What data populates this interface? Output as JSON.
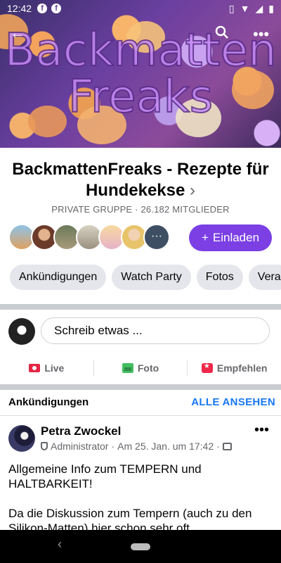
{
  "status": {
    "time": "12:42"
  },
  "cover": {
    "line1": "Backmatten",
    "line2": "Freaks"
  },
  "group": {
    "title": "BackmattenFreaks - Rezepte für Hundekekse",
    "chevron": "›",
    "meta": "PRIVATE GRUPPE · 26.182 MITGLIEDER",
    "invite_label": "Einladen",
    "more_members": "···"
  },
  "tabs": [
    "Ankündigungen",
    "Watch Party",
    "Fotos",
    "Vera"
  ],
  "composer": {
    "placeholder": "Schreib etwas ...",
    "actions": [
      "Live",
      "Foto",
      "Empfehlen"
    ]
  },
  "announcements": {
    "header": "Ankündigungen",
    "see_all": "ALLE ANSEHEN",
    "post": {
      "author": "Petra Zwockel",
      "role": "Administrator",
      "date": "Am 25. Jan. um 17:42",
      "line1": "Allgemeine Info zum TEMPERN und HALTBARKEIT!",
      "line2": "Da die Diskussion zum Tempern (auch zu den Silikon-Matten) hier schon sehr oft..."
    }
  },
  "colors": {
    "accent": "#7b3fe4",
    "link": "#1877f2",
    "chip": "#e4e6eb"
  }
}
